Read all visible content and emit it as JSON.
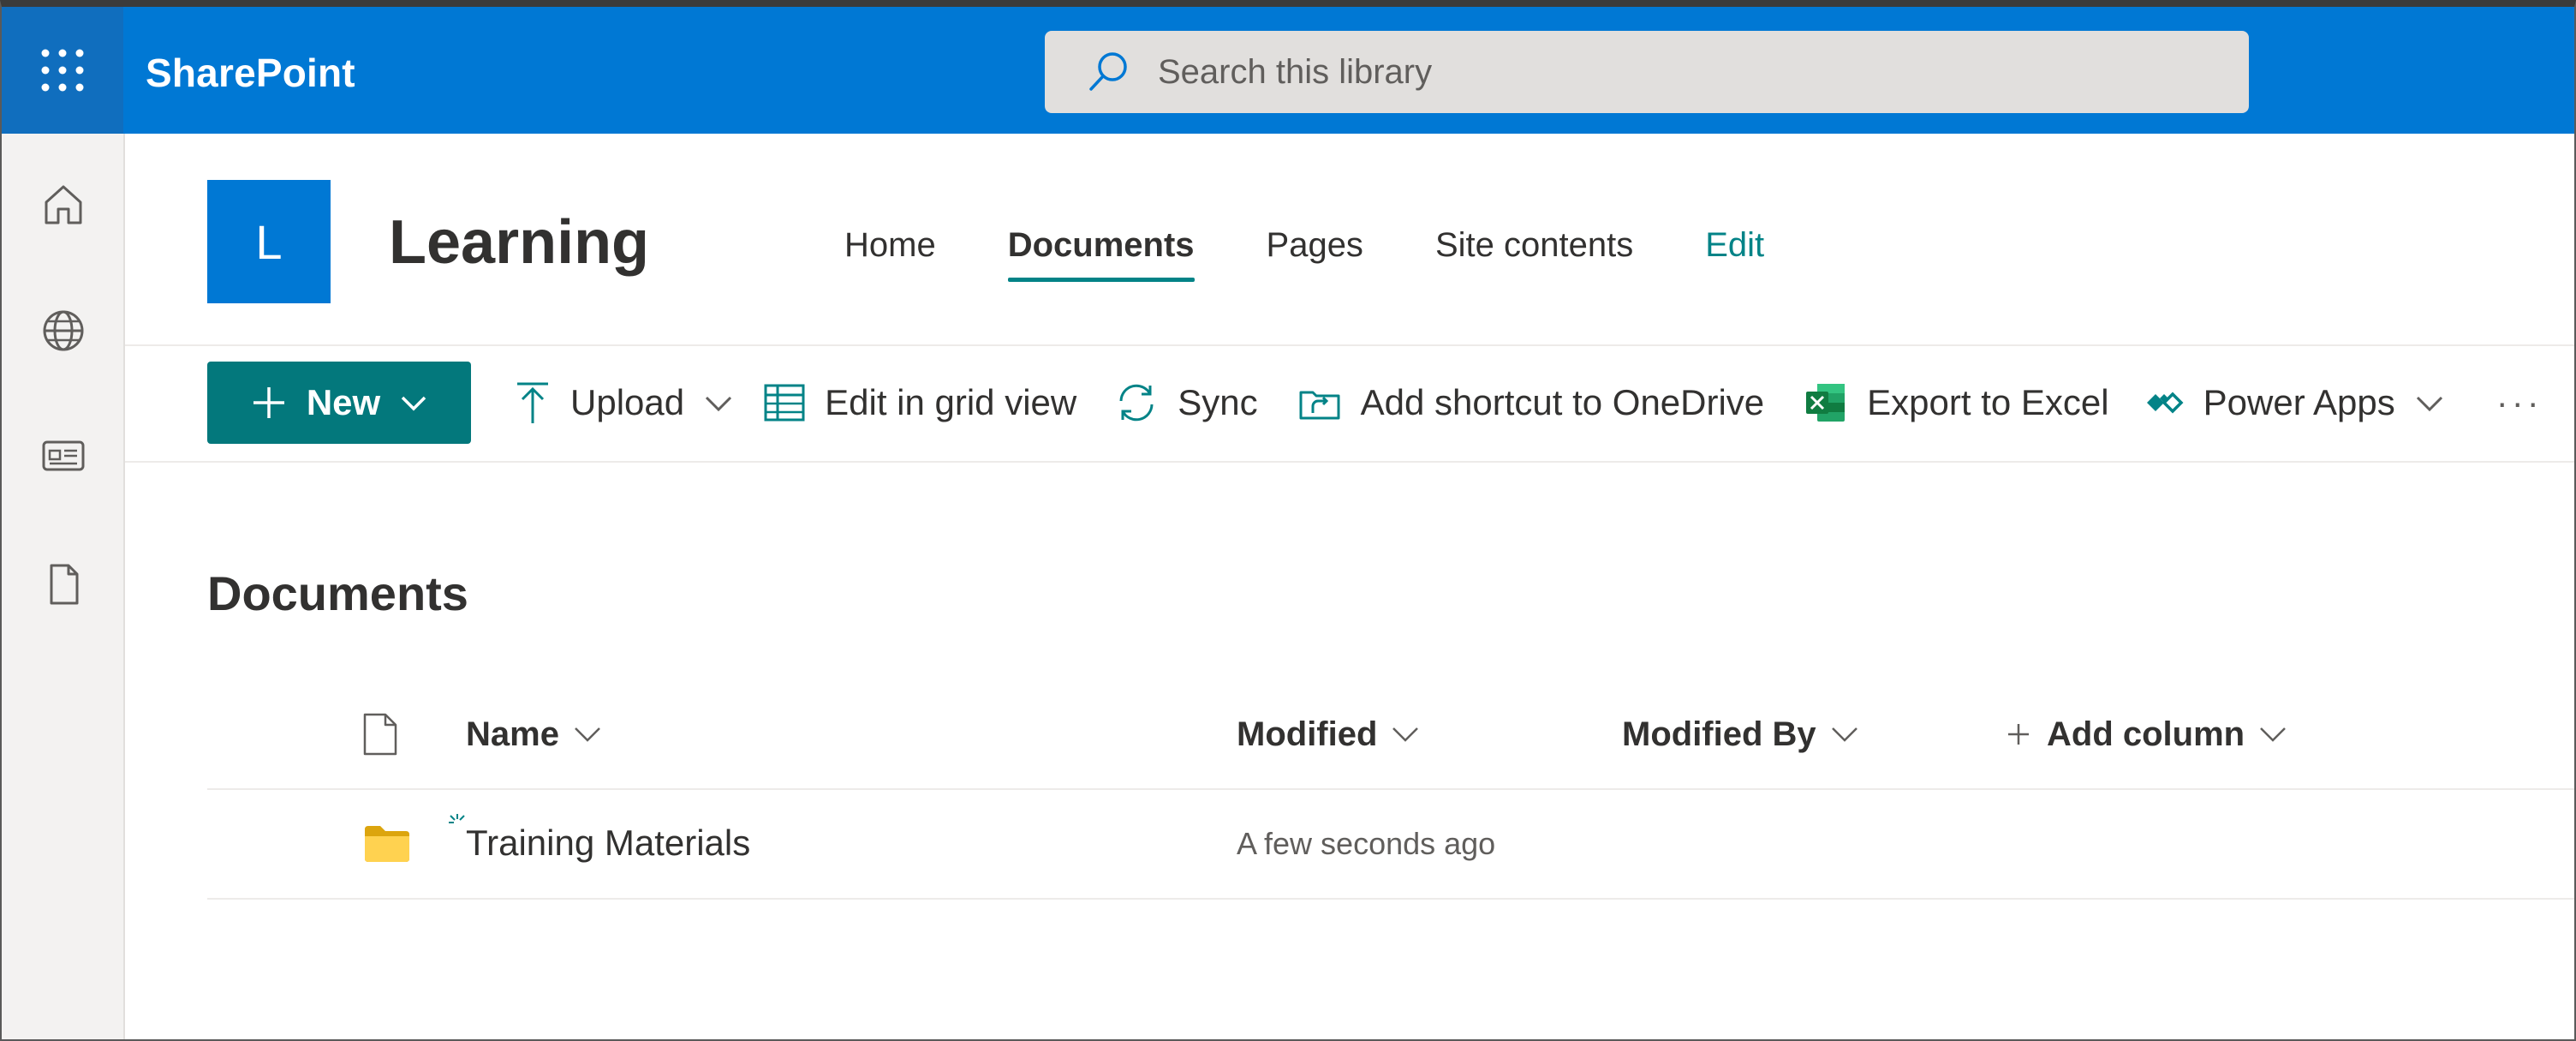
{
  "suite_bar": {
    "brand": "SharePoint",
    "search_placeholder": "Search this library",
    "colors": {
      "bar": "#0078d4",
      "waffle_bg": "#106ebe"
    }
  },
  "left_rail": {
    "items": [
      {
        "icon": "home-icon",
        "label": "Home"
      },
      {
        "icon": "globe-icon",
        "label": "Sites"
      },
      {
        "icon": "news-icon",
        "label": "News"
      },
      {
        "icon": "document-icon",
        "label": "Files"
      }
    ]
  },
  "site": {
    "logo_letter": "L",
    "title": "Learning",
    "nav": [
      {
        "label": "Home",
        "active": false
      },
      {
        "label": "Documents",
        "active": true
      },
      {
        "label": "Pages",
        "active": false
      },
      {
        "label": "Site contents",
        "active": false
      },
      {
        "label": "Edit",
        "active": false
      }
    ]
  },
  "command_bar": {
    "new_label": "New",
    "upload_label": "Upload",
    "grid_label": "Edit in grid view",
    "sync_label": "Sync",
    "shortcut_label": "Add shortcut to OneDrive",
    "export_label": "Export to Excel",
    "powerapps_label": "Power Apps",
    "more_label": "···",
    "accent": "#03787c"
  },
  "library": {
    "title": "Documents",
    "columns": {
      "name": "Name",
      "modified": "Modified",
      "modified_by": "Modified By",
      "add_column": "Add column"
    },
    "rows": [
      {
        "type": "folder-icon",
        "name": "Training Materials",
        "modified": "A few seconds ago",
        "modified_by": ""
      }
    ]
  }
}
